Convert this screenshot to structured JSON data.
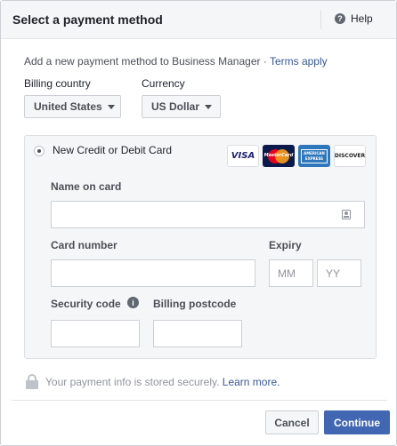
{
  "dialog": {
    "title": "Select a payment method",
    "help_label": "Help",
    "help_icon": "?"
  },
  "intro": {
    "text": "Add a new payment method to Business Manager · ",
    "terms_link": "Terms apply"
  },
  "billing_country": {
    "label": "Billing country",
    "value": "United States"
  },
  "currency": {
    "label": "Currency",
    "value": "US Dollar"
  },
  "card_form": {
    "option_label": "New Credit or Debit Card",
    "card_brands": [
      "VISA",
      "MasterCard",
      "AMERICAN EXPRESS",
      "DISCOVER"
    ],
    "name_on_card": {
      "label": "Name on card",
      "value": ""
    },
    "card_number": {
      "label": "Card number",
      "value": ""
    },
    "expiry": {
      "label": "Expiry",
      "month_placeholder": "MM",
      "year_placeholder": "YY"
    },
    "security_code": {
      "label": "Security code",
      "value": "",
      "info_icon": "i"
    },
    "billing_postcode": {
      "label": "Billing postcode",
      "value": ""
    }
  },
  "security_note": {
    "text": "Your payment info is stored securely. ",
    "learn_more": "Learn more."
  },
  "buttons": {
    "cancel": "Cancel",
    "continue": "Continue"
  },
  "colors": {
    "primary": "#4267b2",
    "link": "#385898",
    "panel_bg": "#f5f6f7"
  }
}
